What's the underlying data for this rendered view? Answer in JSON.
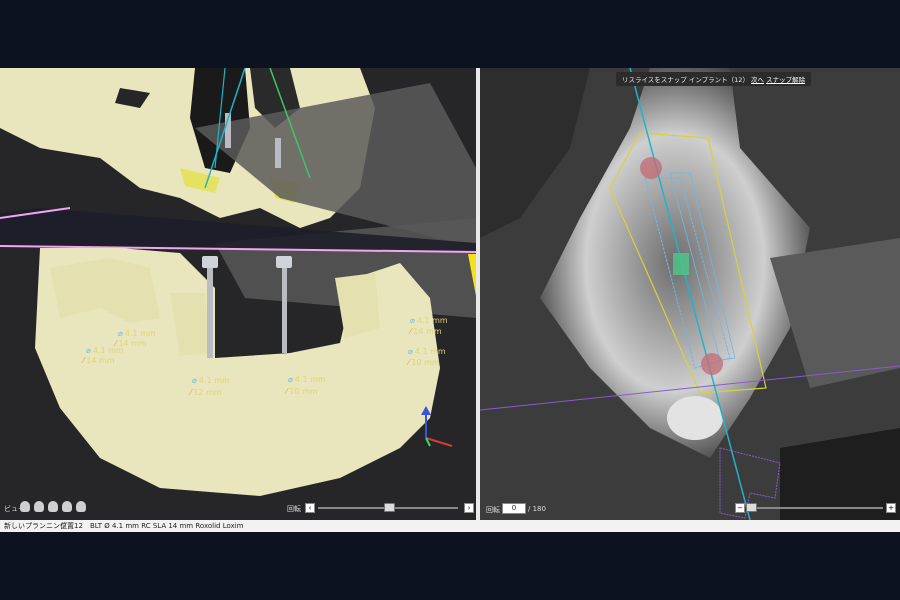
{
  "viewer_3d": {
    "toolbar_label": "ビュー",
    "rotate_label": "回転",
    "implants": [
      {
        "diameter": "4.1 mm",
        "length": "14 mm"
      },
      {
        "diameter": "4.1 mm",
        "length": "14 mm"
      },
      {
        "diameter": "4.1 mm",
        "length": "12 mm"
      },
      {
        "diameter": "4.1 mm",
        "length": "10 mm"
      },
      {
        "diameter": "4.1 mm",
        "length": "14 mm"
      },
      {
        "diameter": "4.1 mm",
        "length": "10 mm"
      }
    ]
  },
  "viewer_ct": {
    "hint_text": "リスライスをスナップ インプラント（12）",
    "hint_next": "次へ",
    "hint_release": "スナップ解除",
    "rotate_label": "回転",
    "rotate_value": "0",
    "rotate_max": "/ 180"
  },
  "statusbar": {
    "project": "新しいプランニング",
    "position_label": "位置",
    "position_value": "12",
    "implant_spec": "BLT  Ø 4.1 mm RC SLA 14 mm Roxolid Loxim"
  },
  "colors": {
    "bone": "#e9e6bd",
    "implant_label": "#e0d27a",
    "axis": "#22b3c9",
    "window": "#0c1220"
  }
}
